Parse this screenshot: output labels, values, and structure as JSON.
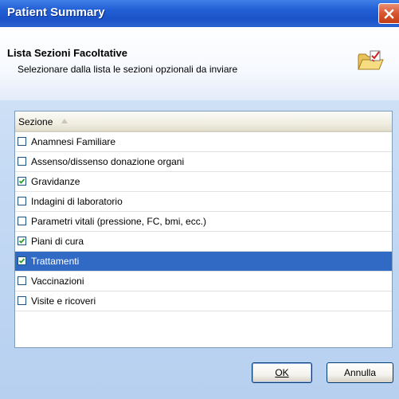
{
  "window": {
    "title": "Patient Summary"
  },
  "header": {
    "title": "Lista Sezioni Facoltative",
    "subtitle": "Selezionare dalla lista le sezioni opzionali da inviare",
    "icon": "folder-checklist-icon"
  },
  "list": {
    "column_header": "Sezione",
    "sort": "ascending",
    "items": [
      {
        "label": "Anamnesi Familiare",
        "checked": false,
        "selected": false
      },
      {
        "label": "Assenso/dissenso donazione organi",
        "checked": false,
        "selected": false
      },
      {
        "label": "Gravidanze",
        "checked": true,
        "selected": false
      },
      {
        "label": "Indagini di laboratorio",
        "checked": false,
        "selected": false
      },
      {
        "label": "Parametri vitali (pressione, FC, bmi, ecc.)",
        "checked": false,
        "selected": false
      },
      {
        "label": "Piani di cura",
        "checked": true,
        "selected": false
      },
      {
        "label": "Trattamenti",
        "checked": true,
        "selected": true
      },
      {
        "label": "Vaccinazioni",
        "checked": false,
        "selected": false
      },
      {
        "label": "Visite e ricoveri",
        "checked": false,
        "selected": false
      }
    ]
  },
  "buttons": {
    "ok_label": "OK",
    "cancel_label": "Annulla"
  },
  "colors": {
    "titlebar": "#2360d6",
    "selection": "#316ac5",
    "close": "#d7552f"
  }
}
